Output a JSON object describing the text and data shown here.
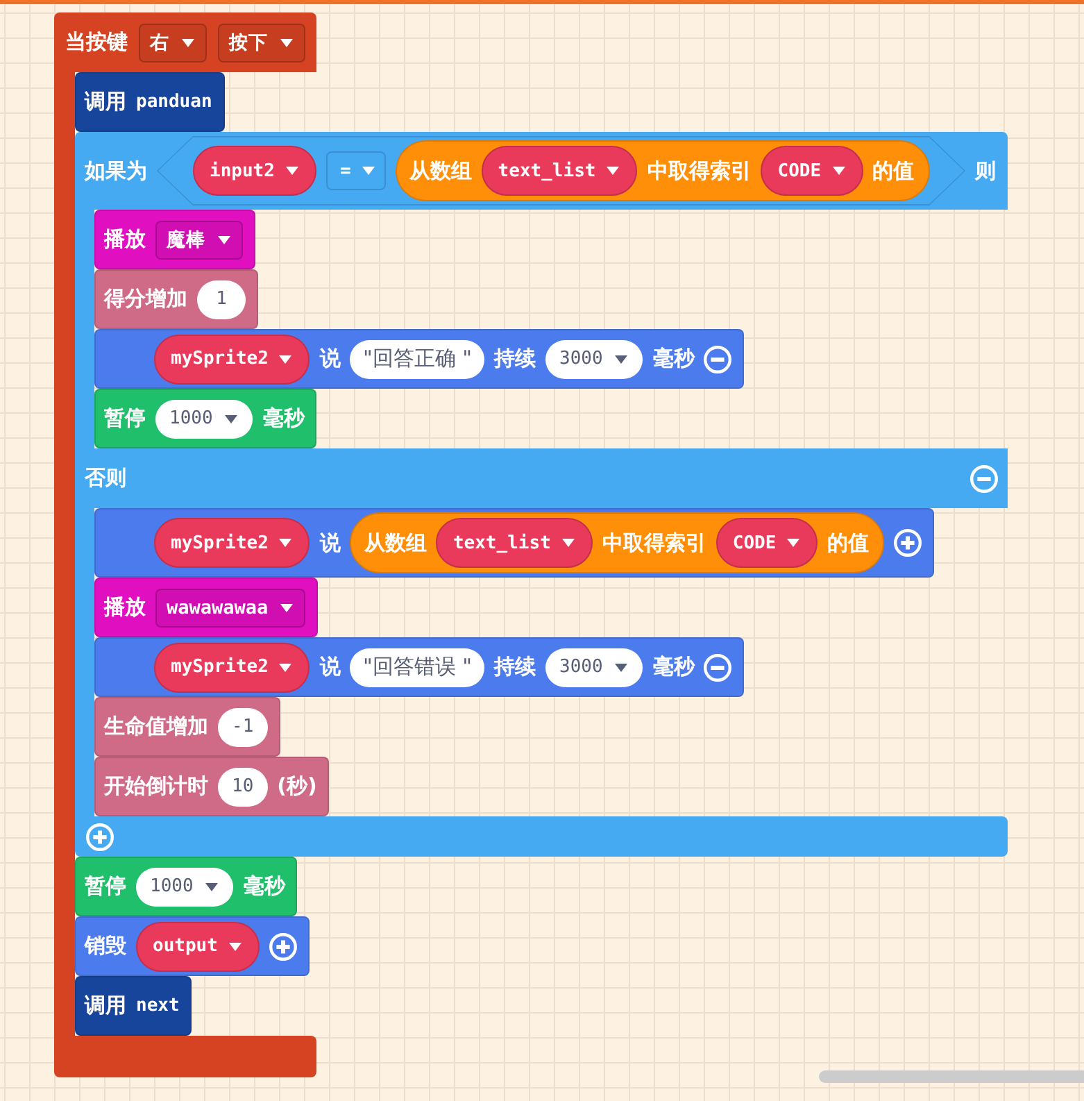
{
  "workspace": {
    "event": {
      "parts": [
        {
          "kind": "label",
          "text": "当按键"
        },
        {
          "kind": "dropdown",
          "text": "右"
        },
        {
          "kind": "dropdown",
          "text": "按下"
        }
      ],
      "body": [
        {
          "kind": "function_call",
          "parts": [
            {
              "kind": "label",
              "text": "调用"
            },
            {
              "kind": "name",
              "text": "panduan"
            }
          ]
        },
        {
          "kind": "if_else",
          "parts": [
            {
              "kind": "label",
              "text": "如果为"
            },
            {
              "kind": "condition",
              "parts": [
                {
                  "kind": "variable",
                  "text": "input2"
                },
                {
                  "kind": "operator",
                  "text": "="
                },
                {
                  "kind": "expression",
                  "parts": [
                    {
                      "kind": "label",
                      "text": "从数组"
                    },
                    {
                      "kind": "variable",
                      "text": "text_list"
                    },
                    {
                      "kind": "label",
                      "text": "中取得索引"
                    },
                    {
                      "kind": "variable",
                      "text": "CODE"
                    },
                    {
                      "kind": "label",
                      "text": "的值"
                    }
                  ]
                }
              ]
            },
            {
              "kind": "label",
              "text": "则"
            }
          ],
          "then": [
            {
              "kind": "play_sound",
              "parts": [
                {
                  "kind": "label",
                  "text": "播放"
                },
                {
                  "kind": "dropdown",
                  "text": "魔棒"
                }
              ]
            },
            {
              "kind": "info",
              "parts": [
                {
                  "kind": "label",
                  "text": "得分增加"
                },
                {
                  "kind": "number",
                  "text": "1"
                }
              ]
            },
            {
              "kind": "sprite",
              "parts": [
                {
                  "kind": "variable",
                  "text": "mySprite2"
                },
                {
                  "kind": "label",
                  "text": "说"
                },
                {
                  "kind": "string",
                  "text": "\"回答正确 \""
                },
                {
                  "kind": "label",
                  "text": "持续"
                },
                {
                  "kind": "number_dropdown",
                  "text": "3000"
                },
                {
                  "kind": "label",
                  "text": "毫秒"
                }
              ],
              "minus_button": true
            },
            {
              "kind": "pause",
              "parts": [
                {
                  "kind": "label",
                  "text": "暂停"
                },
                {
                  "kind": "number_dropdown",
                  "text": "1000"
                },
                {
                  "kind": "label",
                  "text": "毫秒"
                }
              ]
            }
          ],
          "else_parts": [
            {
              "kind": "label",
              "text": "否则"
            }
          ],
          "else_minus_button": true,
          "else": [
            {
              "kind": "sprite",
              "parts": [
                {
                  "kind": "variable",
                  "text": "mySprite2"
                },
                {
                  "kind": "label",
                  "text": "说"
                },
                {
                  "kind": "expression",
                  "parts": [
                    {
                      "kind": "label",
                      "text": "从数组"
                    },
                    {
                      "kind": "variable",
                      "text": "text_list"
                    },
                    {
                      "kind": "label",
                      "text": "中取得索引"
                    },
                    {
                      "kind": "variable",
                      "text": "CODE"
                    },
                    {
                      "kind": "label",
                      "text": "的值"
                    }
                  ]
                }
              ],
              "plus_button": true
            },
            {
              "kind": "play_sound",
              "parts": [
                {
                  "kind": "label",
                  "text": "播放"
                },
                {
                  "kind": "dropdown",
                  "text": "wawawawaa"
                }
              ]
            },
            {
              "kind": "sprite",
              "parts": [
                {
                  "kind": "variable",
                  "text": "mySprite2"
                },
                {
                  "kind": "label",
                  "text": "说"
                },
                {
                  "kind": "string",
                  "text": "\"回答错误 \""
                },
                {
                  "kind": "label",
                  "text": "持续"
                },
                {
                  "kind": "number_dropdown",
                  "text": "3000"
                },
                {
                  "kind": "label",
                  "text": "毫秒"
                }
              ],
              "minus_button": true
            },
            {
              "kind": "info",
              "parts": [
                {
                  "kind": "label",
                  "text": "生命值增加"
                },
                {
                  "kind": "number",
                  "text": "-1"
                }
              ]
            },
            {
              "kind": "info",
              "parts": [
                {
                  "kind": "label",
                  "text": "开始倒计时"
                },
                {
                  "kind": "number",
                  "text": "10"
                },
                {
                  "kind": "label",
                  "text": "(秒)"
                }
              ]
            }
          ],
          "footer_plus_button": true
        },
        {
          "kind": "pause",
          "parts": [
            {
              "kind": "label",
              "text": "暂停"
            },
            {
              "kind": "number_dropdown",
              "text": "1000"
            },
            {
              "kind": "label",
              "text": "毫秒"
            }
          ]
        },
        {
          "kind": "sprite",
          "parts": [
            {
              "kind": "label",
              "text": "销毁"
            },
            {
              "kind": "variable",
              "text": "output"
            }
          ],
          "plus_button": true
        },
        {
          "kind": "function_call",
          "parts": [
            {
              "kind": "label",
              "text": "调用"
            },
            {
              "kind": "name",
              "text": "next"
            }
          ]
        }
      ]
    }
  }
}
